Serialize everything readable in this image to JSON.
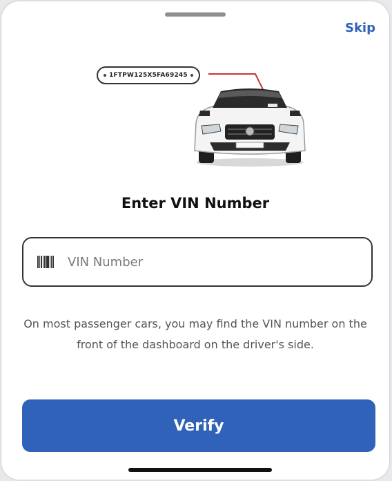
{
  "header": {
    "skip_label": "Skip"
  },
  "illustration": {
    "vin_example": "1FTPW125X5FA69245"
  },
  "main": {
    "title": "Enter VIN Number",
    "vin_input": {
      "value": "",
      "placeholder": "VIN Number"
    },
    "help_text": "On most passenger cars, you may find the VIN number on the front of the dashboard on the driver's side."
  },
  "actions": {
    "verify_label": "Verify"
  },
  "colors": {
    "accent": "#2f62b8",
    "text": "#111111",
    "muted": "#555555"
  }
}
